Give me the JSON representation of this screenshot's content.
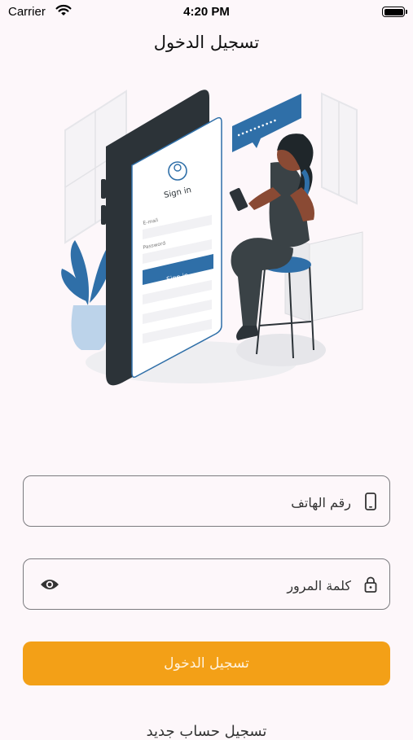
{
  "status_bar": {
    "carrier": "Carrier",
    "time": "4:20 PM"
  },
  "header": {
    "title": "تسجيل الدخول"
  },
  "illustration": {
    "screen_title": "Sign in",
    "email_label": "E-mail",
    "password_label": "Password",
    "button_label": "Sign in",
    "bubble_text": "••••••••••"
  },
  "form": {
    "phone_placeholder": "رقم الهاتف",
    "password_placeholder": "كلمة المرور",
    "submit_label": "تسجيل الدخول"
  },
  "footer": {
    "text": "تسجيل حساب جديد"
  },
  "colors": {
    "accent": "#f3a017",
    "illustration_blue": "#2f6fa8",
    "background": "#fdf7fa"
  }
}
